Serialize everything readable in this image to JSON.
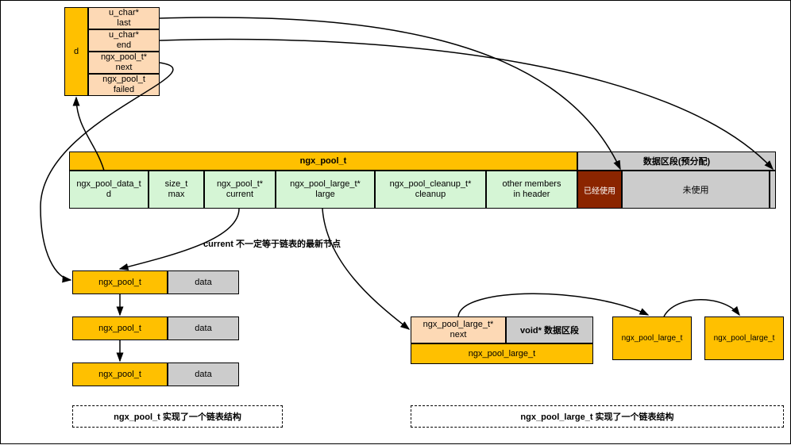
{
  "top_struct": {
    "header": "d",
    "fields": [
      "u_char*\nlast",
      "u_char*\nend",
      "ngx_pool_t*\nnext",
      "ngx_pool_t\nfailed"
    ]
  },
  "main_bar": {
    "title": "ngx_pool_t",
    "data_header": "数据区段(预分配)",
    "fields": [
      "ngx_pool_data_t\nd",
      "size_t\nmax",
      "ngx_pool_t*\ncurrent",
      "ngx_pool_large_t*\nlarge",
      "ngx_pool_cleanup_t*\ncleanup",
      "other members\nin header"
    ],
    "used": "已经使用",
    "unused": "未使用"
  },
  "note_current": "current 不一定等于链表的最新节点",
  "pool_list": {
    "item_label": "ngx_pool_t",
    "data_label": "data",
    "caption": "ngx_pool_t 实现了一个链表结构"
  },
  "large_block": {
    "next": "ngx_pool_large_t*\nnext",
    "voidptr": "void* 数据区段",
    "title": "ngx_pool_large_t",
    "chain_label": "ngx_pool_large_t",
    "caption": "ngx_pool_large_t 实现了一个链表结构"
  }
}
